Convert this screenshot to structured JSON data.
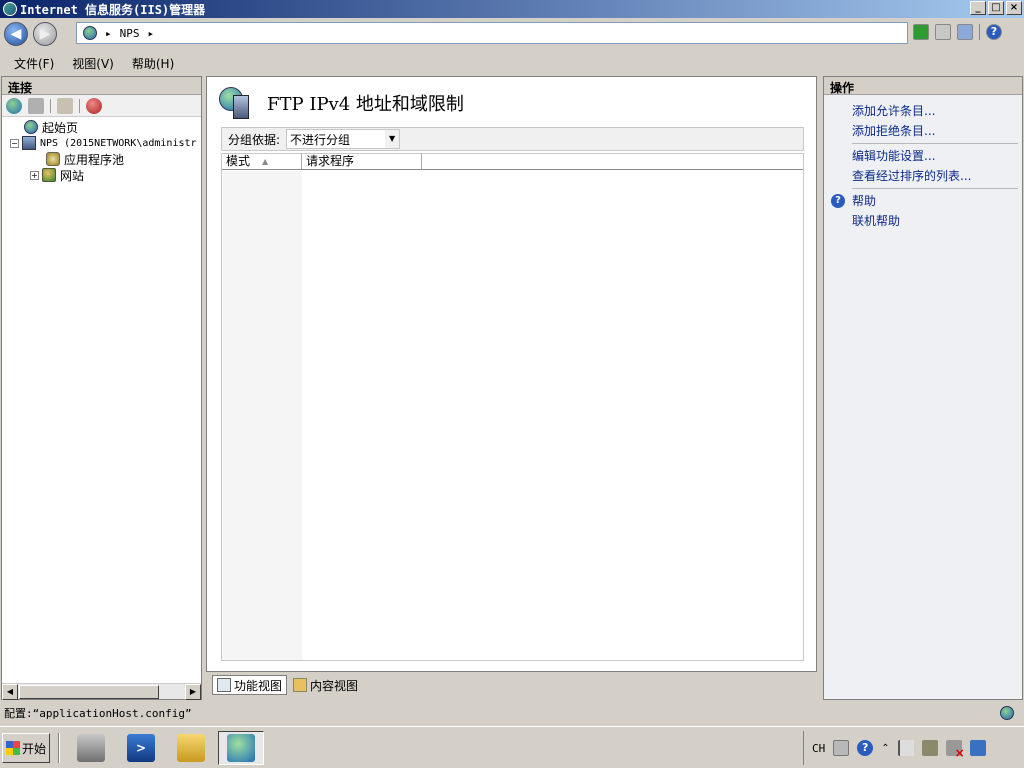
{
  "window": {
    "title": "Internet 信息服务(IIS)管理器",
    "buttons": [
      "_",
      "□",
      "×"
    ]
  },
  "address": {
    "crumbs": [
      "NPS"
    ]
  },
  "menu": {
    "items": [
      "文件(F)",
      "视图(V)",
      "帮助(H)"
    ]
  },
  "connections": {
    "header": "连接",
    "tree": [
      {
        "label": "起始页",
        "icon": "start-page-icon"
      },
      {
        "label": "NPS (2015NETWORK\\administr",
        "icon": "server-icon"
      },
      {
        "label": "应用程序池",
        "icon": "app-pool-icon"
      },
      {
        "label": "网站",
        "icon": "sites-icon"
      }
    ]
  },
  "feature": {
    "title": "FTP IPv4 地址和域限制",
    "group_label": "分组依据:",
    "group_value": "不进行分组",
    "columns": [
      "模式",
      "请求程序"
    ]
  },
  "view_tabs": {
    "feature_view": "功能视图",
    "content_view": "内容视图"
  },
  "actions": {
    "header": "操作",
    "group1": [
      "添加允许条目...",
      "添加拒绝条目..."
    ],
    "group2": [
      "编辑功能设置...",
      "查看经过排序的列表..."
    ],
    "group3": [
      "帮助",
      "联机帮助"
    ]
  },
  "status": {
    "text": "配置:“applicationHost.config”"
  },
  "taskbar": {
    "start": "开始",
    "tray_lang": "CH"
  }
}
